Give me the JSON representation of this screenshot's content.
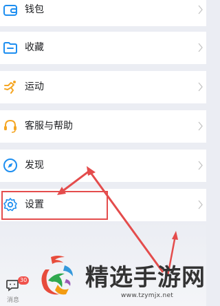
{
  "menu": {
    "items": [
      {
        "label": "钱包",
        "icon": "wallet-icon"
      },
      {
        "label": "收藏",
        "icon": "favorites-folder-icon"
      },
      {
        "label": "运动",
        "icon": "running-icon"
      },
      {
        "label": "客服与帮助",
        "icon": "headset-icon"
      },
      {
        "label": "发现",
        "icon": "compass-icon"
      },
      {
        "label": "设置",
        "icon": "gear-icon"
      }
    ]
  },
  "tabbar": {
    "messages_label": "消息",
    "messages_badge": "30"
  },
  "watermark": {
    "title": "精选手游网",
    "url": "www.tzymjx.net"
  },
  "colors": {
    "accent": "#1d8ef0",
    "orange": "#f5a623",
    "annotation": "#e44c4c",
    "background": "#ebedf3"
  }
}
